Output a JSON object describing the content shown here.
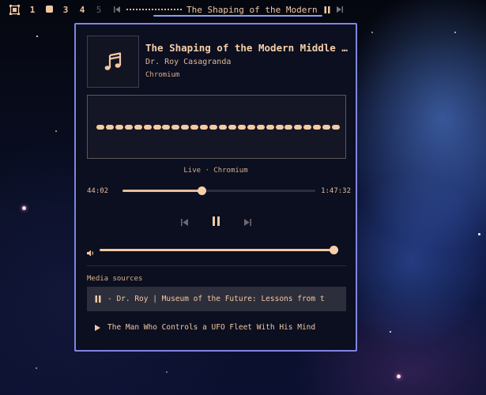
{
  "topbar": {
    "workspaces": [
      "1",
      "3",
      "4",
      "5"
    ],
    "title": "The Shaping of the Modern"
  },
  "player": {
    "title": "The Shaping of the Modern Middle East",
    "artist": "Dr. Roy Casagranda",
    "player_name": "Chromium",
    "status": "Live · Chromium",
    "elapsed": "44:02",
    "total": "1:47:32",
    "progress_fraction": 0.41,
    "volume_fraction": 1.0,
    "visualizer_bar_count": 26
  },
  "sources": {
    "heading": "Media sources",
    "items": [
      {
        "label": " - Dr. Roy | Museum of the Future: Lessons from t",
        "state": "playing",
        "active": true
      },
      {
        "label": "The Man Who Controls a UFO Fleet With His Mind",
        "state": "paused",
        "active": false
      }
    ]
  },
  "colors": {
    "accent": "#f2c8a2",
    "panel_border": "#7f86e0",
    "panel_bg": "#0b0f1f"
  }
}
